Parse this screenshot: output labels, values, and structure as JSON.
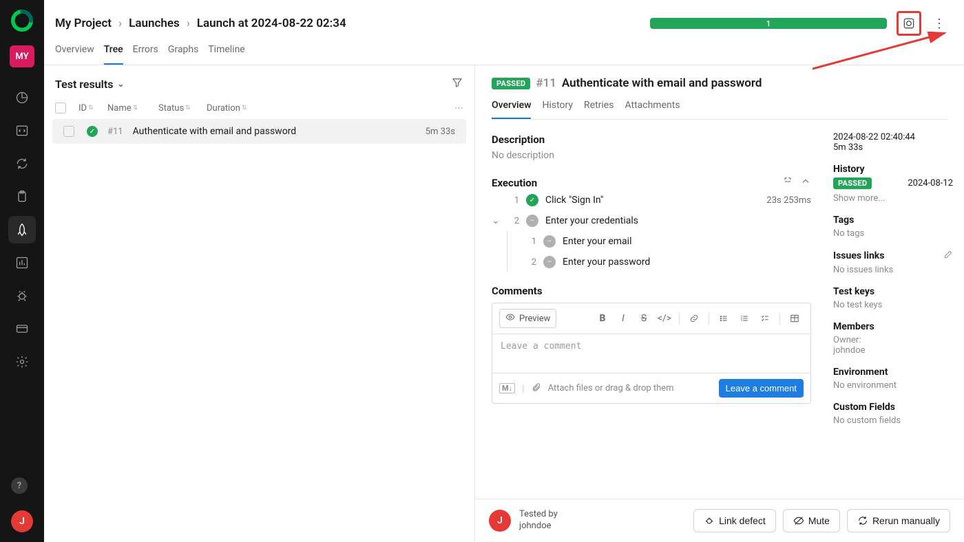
{
  "sidebar": {
    "project_abbrev": "MY",
    "help": "?",
    "user_initial": "J"
  },
  "breadcrumb": [
    "My Project",
    "Launches",
    "Launch at 2024-08-22 02:34"
  ],
  "progress_count": "1",
  "top_tabs": [
    "Overview",
    "Tree",
    "Errors",
    "Graphs",
    "Timeline"
  ],
  "results": {
    "title": "Test results",
    "columns": [
      "ID",
      "Name",
      "Status",
      "Duration"
    ],
    "row": {
      "id": "#11",
      "name": "Authenticate with email and password",
      "duration": "5m 33s"
    }
  },
  "detail": {
    "status": "PASSED",
    "id": "#11",
    "title": "Authenticate with email and password",
    "tabs": [
      "Overview",
      "History",
      "Retries",
      "Attachments"
    ],
    "desc_label": "Description",
    "desc_value": "No description",
    "exec_label": "Execution",
    "steps": [
      {
        "n": "1",
        "text": "Click \"Sign In\"",
        "time": "23s 253ms"
      },
      {
        "n": "2",
        "text": "Enter your credentials"
      }
    ],
    "substeps": [
      {
        "n": "1",
        "text": "Enter your email"
      },
      {
        "n": "2",
        "text": "Enter your password"
      }
    ],
    "comments_label": "Comments",
    "preview_label": "Preview",
    "comment_placeholder": "Leave a comment",
    "attach_hint": "Attach files or drag & drop them",
    "leave_btn": "Leave a comment"
  },
  "side": {
    "timestamp": "2024-08-22 02:40:44",
    "duration": "5m 33s",
    "history_label": "History",
    "history_status": "PASSED",
    "history_date": "2024-08-12",
    "show_more": "Show more...",
    "tags_label": "Tags",
    "tags_value": "No tags",
    "issues_label": "Issues links",
    "issues_value": "No issues links",
    "keys_label": "Test keys",
    "keys_value": "No test keys",
    "members_label": "Members",
    "owner_label": "Owner:",
    "owner_name": "johndoe",
    "env_label": "Environment",
    "env_value": "No environment",
    "custom_label": "Custom Fields",
    "custom_value": "No custom fields"
  },
  "footer": {
    "tested_by_label": "Tested by",
    "tested_by_name": "johndoe",
    "avatar_initial": "J",
    "link_defect": "Link defect",
    "mute": "Mute",
    "rerun": "Rerun manually"
  }
}
